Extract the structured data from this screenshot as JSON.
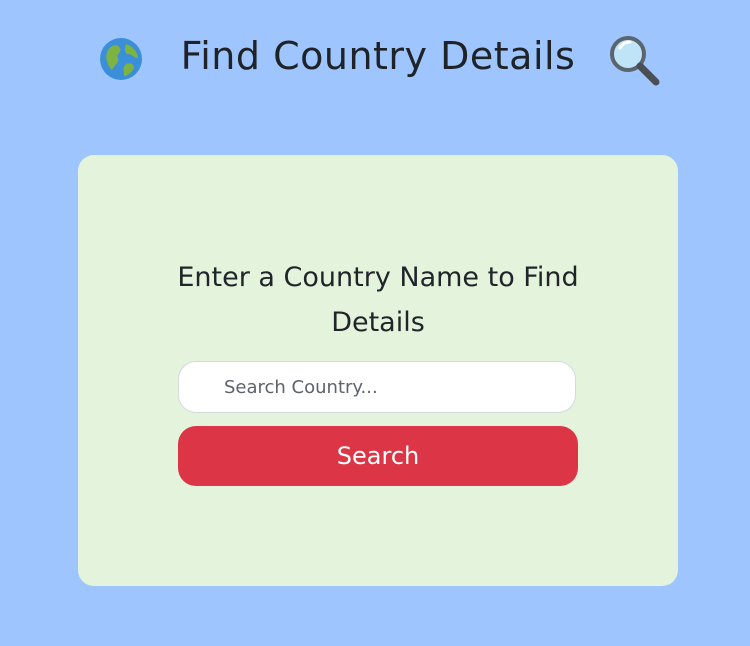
{
  "header": {
    "title": "Find Country Details",
    "left_icon": "globe-icon",
    "right_icon": "magnifier-icon"
  },
  "card": {
    "prompt": "Enter a Country Name to Find Details",
    "search": {
      "placeholder": "Search Country...",
      "value": ""
    },
    "search_button_label": "Search"
  },
  "colors": {
    "page_background": "#9ec5fe",
    "card_background": "#e4f3dc",
    "button_background": "#dc3545",
    "button_text": "#ffffff"
  }
}
